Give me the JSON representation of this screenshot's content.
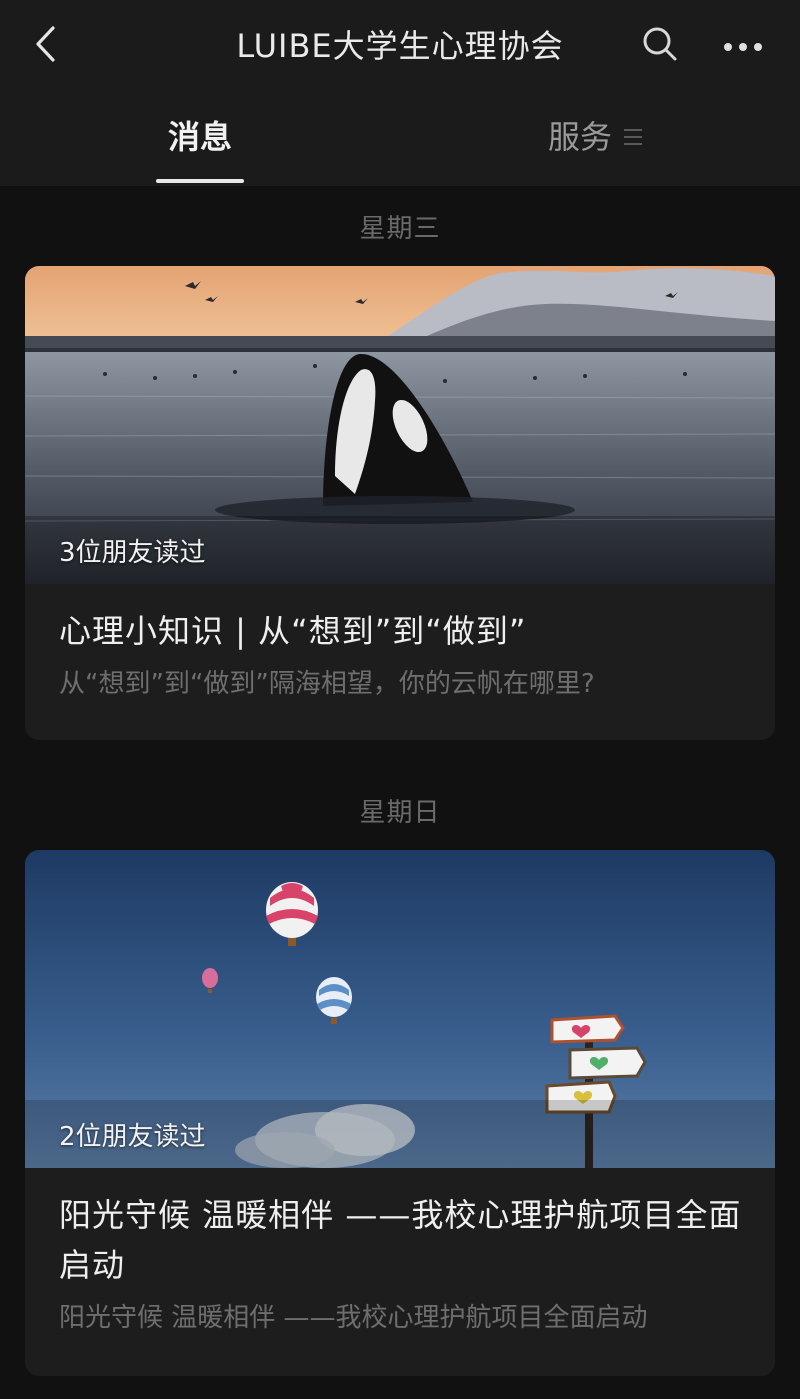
{
  "header": {
    "title": "LUIBE大学生心理协会",
    "back_icon": "chevron-left-icon",
    "search_icon": "search-icon",
    "more_icon": "more-dots-icon"
  },
  "tabs": {
    "messages_label": "消息",
    "services_label": "服务",
    "services_icon": "menu-icon"
  },
  "feed": [
    {
      "date": "星期三",
      "read_count": "3位朋友读过",
      "title": "心理小知识 | 从“想到”到“做到”",
      "subtitle": "从“想到”到“做到”隔海相望，你的云帆在哪里?"
    },
    {
      "date": "星期日",
      "read_count": "2位朋友读过",
      "title": "阳光守候 温暖相伴 ——我校心理护航项目全面启动",
      "subtitle": "阳光守候 温暖相伴 ——我校心理护航项目全面启动"
    }
  ],
  "colors": {
    "background": "#111111",
    "surface": "#1d1d1d",
    "bar": "#1b1b1b"
  }
}
